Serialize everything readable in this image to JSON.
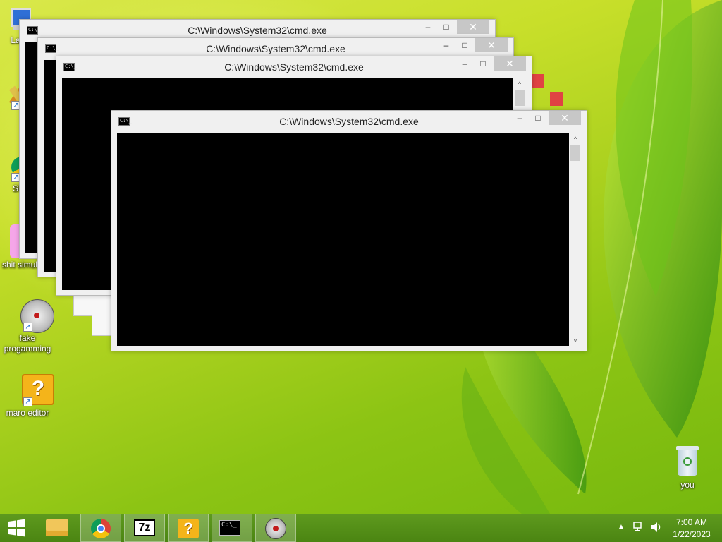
{
  "desktop": {
    "icons": [
      {
        "label": "La"
      },
      {
        "label": ""
      },
      {
        "label": "SP"
      },
      {
        "label": "shit simul"
      },
      {
        "label": "fake\nprogamming"
      },
      {
        "label": "maro editor"
      },
      {
        "label": "you"
      }
    ]
  },
  "windows": [
    {
      "title": "C:\\Windows\\System32\\cmd.exe",
      "state": "background"
    },
    {
      "title": "C:\\Windows\\System32\\cmd.exe",
      "state": "background"
    },
    {
      "title": "C:\\Windows\\System32\\cmd.exe",
      "state": "background"
    },
    {
      "title": "C:\\Windows\\System32\\cmd.exe",
      "state": "active"
    }
  ],
  "window_controls": {
    "minimize": "–",
    "maximize": "□",
    "close": "✕"
  },
  "console_icon_text": "C:\\_",
  "taskbar": {
    "buttons": [
      {
        "name": "start",
        "icon": "windows-logo-icon"
      },
      {
        "name": "file-explorer",
        "icon": "folder-icon"
      },
      {
        "name": "chrome",
        "icon": "chrome-icon"
      },
      {
        "name": "7zip",
        "icon": "7zip-icon",
        "text": "7z"
      },
      {
        "name": "maro-editor",
        "icon": "question-block-icon",
        "text": "?"
      },
      {
        "name": "cmd",
        "icon": "console-icon",
        "text": "C:\\_"
      },
      {
        "name": "fake-programming",
        "icon": "app-compass-icon"
      }
    ],
    "time": "7:00 AM",
    "date": "1/22/2023",
    "tray_icons": [
      "show-hidden-icons-chevron",
      "network-icon",
      "volume-icon"
    ]
  },
  "colors": {
    "accent": "#4b8512",
    "console": "#000000",
    "close_red": "#e04343"
  }
}
